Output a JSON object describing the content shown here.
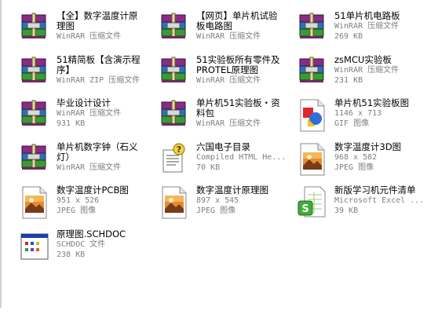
{
  "files": [
    {
      "name": "【全】数字温度计原\n理图",
      "line1": "WinRAR 压缩文件",
      "line2": "",
      "icon": "winrar-icon"
    },
    {
      "name": "【网页】单片机试验\n板电路图",
      "line1": "WinRAR 压缩文件",
      "line2": "",
      "icon": "winrar-icon"
    },
    {
      "name": "51单片机电路板",
      "line1": "WinRAR 压缩文件",
      "line2": "269 KB",
      "icon": "winrar-icon"
    },
    {
      "name": "51精简板【含演示程\n序】",
      "line1": "WinRAR ZIP 压缩文件",
      "line2": "",
      "icon": "winrar-icon"
    },
    {
      "name": "51实验板所有零件及\nPROTEL原理图",
      "line1": "WinRAR 压缩文件",
      "line2": "",
      "icon": "winrar-icon"
    },
    {
      "name": "zsMCU实验板",
      "line1": "WinRAR 压缩文件",
      "line2": "231 KB",
      "icon": "winrar-icon"
    },
    {
      "name": "毕业设计设计",
      "line1": "WinRAR 压缩文件",
      "line2": "931 KB",
      "icon": "winrar-icon"
    },
    {
      "name": "单片机51实验板・资\n料包",
      "line1": "WinRAR 压缩文件",
      "line2": "",
      "icon": "winrar-icon"
    },
    {
      "name": "单片机51实验板图",
      "line1": "1146 x 713",
      "line2": "GIF 图像",
      "icon": "gif-image-icon"
    },
    {
      "name": "单片机数字钟（石义\n灯）",
      "line1": "WinRAR 压缩文件",
      "line2": "",
      "icon": "winrar-icon"
    },
    {
      "name": "六国电子目录",
      "line1": "Compiled HTML He...",
      "line2": "70 KB",
      "icon": "chm-help-icon"
    },
    {
      "name": "数字温度计3D图",
      "line1": "968 x 582",
      "line2": "JPEG 图像",
      "icon": "jpeg-image-icon"
    },
    {
      "name": "数字温度计PCB图",
      "line1": "951 x 526",
      "line2": "JPEG 图像",
      "icon": "jpeg-image-icon"
    },
    {
      "name": "数字温度计原理图",
      "line1": "897 x 545",
      "line2": "JPEG 图像",
      "icon": "jpeg-image-icon"
    },
    {
      "name": "新版学习机元件清单",
      "line1": "Microsoft Excel ...",
      "line2": "39 KB",
      "icon": "excel-icon"
    },
    {
      "name": "原理图.SCHDOC",
      "line1": "SCHDOC 文件",
      "line2": "238 KB",
      "icon": "schdoc-icon"
    }
  ]
}
